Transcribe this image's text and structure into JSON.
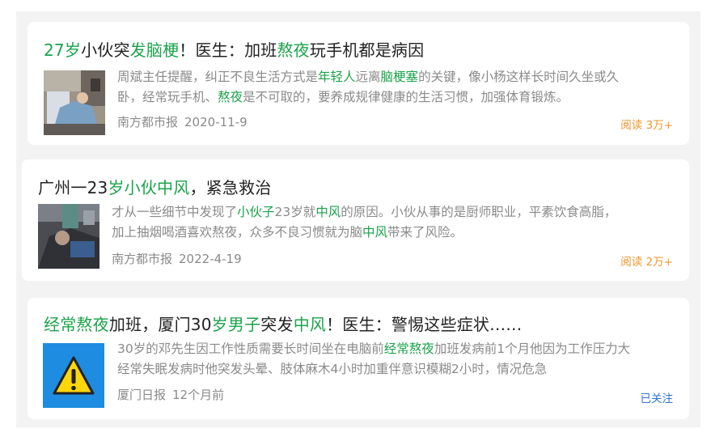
{
  "colors": {
    "highlight": "#1aa34a",
    "reads": "#f0952f",
    "follow": "#2f73d8"
  },
  "articles": [
    {
      "title": [
        {
          "t": "27岁",
          "hl": true
        },
        {
          "t": "小伙突"
        },
        {
          "t": "发脑梗",
          "hl": true
        },
        {
          "t": "！医生：加班"
        },
        {
          "t": "熬夜",
          "hl": true
        },
        {
          "t": "玩手机都是病因"
        }
      ],
      "summary": [
        [
          {
            "t": "周斌主任提醒，纠正不良生活方式是"
          },
          {
            "t": "年轻人",
            "hl": true
          },
          {
            "t": "远离"
          },
          {
            "t": "脑梗塞",
            "hl": true
          },
          {
            "t": "的关键，像小杨这样长时间久坐或久"
          }
        ],
        [
          {
            "t": "卧，经常玩手机、"
          },
          {
            "t": "熬夜",
            "hl": true
          },
          {
            "t": "是不可取的，要养成规律健康的生活习惯，加强体育锻炼。"
          }
        ]
      ],
      "source": "南方都市报",
      "date": "2020-11-9",
      "right_text": "阅读 3万+",
      "right_type": "reads",
      "thumb_icon": "hospital-patient-photo"
    },
    {
      "title": [
        {
          "t": "广州一23"
        },
        {
          "t": "岁小伙中风",
          "hl": true
        },
        {
          "t": "，紧急救治"
        }
      ],
      "summary": [
        [
          {
            "t": "才从一些细节中发现了"
          },
          {
            "t": "小伙子",
            "hl": true
          },
          {
            "t": "23岁就"
          },
          {
            "t": "中风",
            "hl": true
          },
          {
            "t": "的原因。小伙从事的是厨师职业，平素饮食高脂，"
          }
        ],
        [
          {
            "t": "加上抽烟喝酒喜欢熬夜，众多不良习惯就为脑"
          },
          {
            "t": "中风",
            "hl": true
          },
          {
            "t": "带来了风险。"
          }
        ]
      ],
      "source": "南方都市报",
      "date": "2022-4-19",
      "right_text": "阅读 2万+",
      "right_type": "reads",
      "thumb_icon": "hospital-patient-photo"
    },
    {
      "title": [
        {
          "t": "经常熬夜",
          "hl": true
        },
        {
          "t": "加班，厦门30"
        },
        {
          "t": "岁男子",
          "hl": true
        },
        {
          "t": "突发"
        },
        {
          "t": "中风",
          "hl": true
        },
        {
          "t": "！医生：警惕这些症状……"
        }
      ],
      "summary": [
        [
          {
            "t": "30岁的邓先生因工作性质需要长时间坐在电脑前"
          },
          {
            "t": "经常熬夜",
            "hl": true
          },
          {
            "t": "加班发病前1个月他因为工作压力大"
          }
        ],
        [
          {
            "t": "经常失眠发病时他突发头晕、肢体麻木4小时加重伴意识模糊2小时，情况危急"
          }
        ]
      ],
      "source": "厦门日报",
      "date": "12个月前",
      "right_text": "已关注",
      "right_type": "follow",
      "thumb_icon": "warning-icon"
    }
  ]
}
